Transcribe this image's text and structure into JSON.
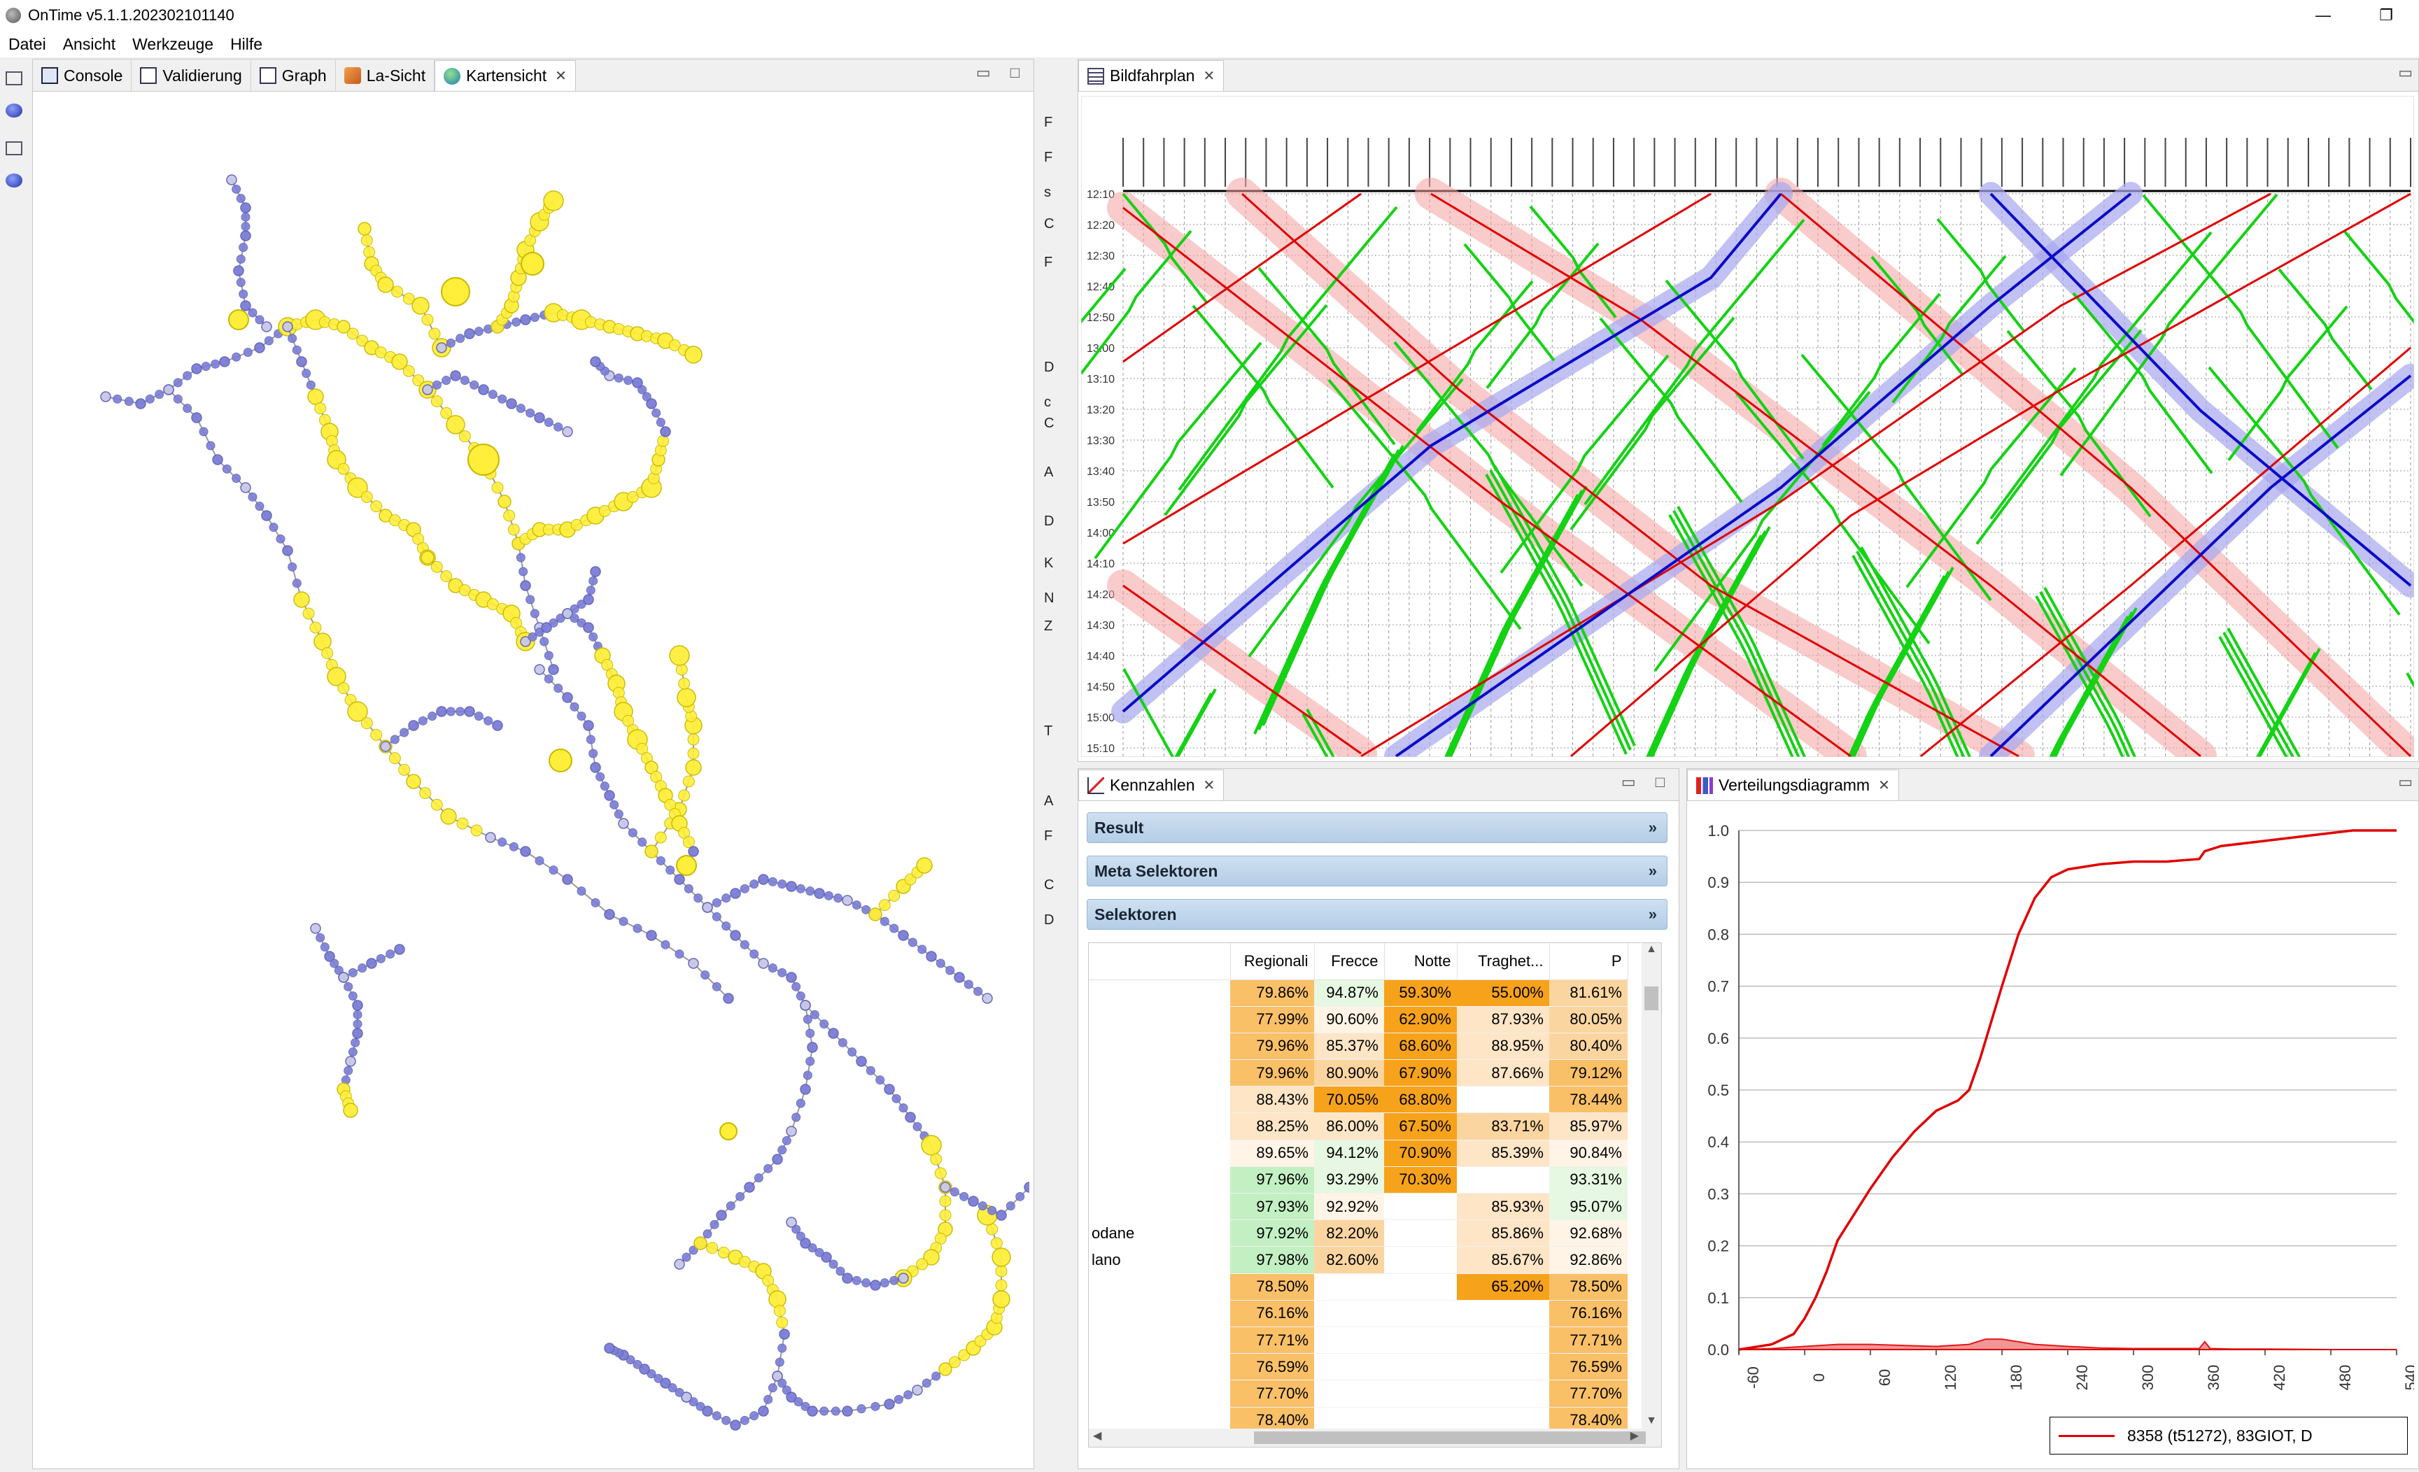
{
  "window": {
    "title": "OnTime v5.1.1.202302101140",
    "minimize": "—",
    "restore": "❐"
  },
  "menu": [
    "Datei",
    "Ansicht",
    "Werkzeuge",
    "Hilfe"
  ],
  "left_panel": {
    "tabs": [
      {
        "label": "Console",
        "icon": "console-icon"
      },
      {
        "label": "Validierung",
        "icon": "validation-icon"
      },
      {
        "label": "Graph",
        "icon": "graph-icon"
      },
      {
        "label": "La-Sicht",
        "icon": "la-view-icon"
      },
      {
        "label": "Kartensicht",
        "icon": "globe-icon",
        "active": true,
        "closable": true
      }
    ],
    "map": {
      "description_colors": {
        "lines": "#7b7ed6",
        "stations_a": "#ffef3a",
        "stations_b": "#c9c9e8"
      }
    }
  },
  "hidden_panel_letters": [
    "F",
    "F",
    "s",
    "C",
    "F",
    "D",
    "c",
    "C",
    "A",
    "D",
    "K",
    "N",
    "Z",
    "T",
    "A",
    "F",
    "C",
    "D"
  ],
  "bildfahrplan": {
    "tab_label": "Bildfahrplan",
    "time_labels": [
      "12:10",
      "12:20",
      "12:30",
      "12:40",
      "12:50",
      "13:00",
      "13:10",
      "13:20",
      "13:30",
      "13:40",
      "13:50",
      "14:00",
      "14:10",
      "14:20",
      "14:30",
      "14:40",
      "14:50",
      "15:00",
      "15:10"
    ],
    "colors": {
      "red": "#e00000",
      "blue": "#0a0ac8",
      "green": "#14d214",
      "red_band": "#f4a0a0",
      "blue_band": "#a7a7ee"
    }
  },
  "kennzahlen": {
    "tab_label": "Kennzahlen",
    "sections": [
      "Result",
      "Meta Selektoren",
      "Selektoren"
    ],
    "columns": [
      "",
      "Regionali",
      "Frecce",
      "Notte",
      "Traghet...",
      "P"
    ],
    "rows": [
      {
        "label": "",
        "cells": [
          "79.86%",
          "94.87%",
          "59.30%",
          "55.00%",
          "81.61%"
        ]
      },
      {
        "label": "",
        "cells": [
          "77.99%",
          "90.60%",
          "62.90%",
          "87.93%",
          "80.05%"
        ]
      },
      {
        "label": "",
        "cells": [
          "79.96%",
          "85.37%",
          "68.60%",
          "88.95%",
          "80.40%"
        ]
      },
      {
        "label": "",
        "cells": [
          "79.96%",
          "80.90%",
          "67.90%",
          "87.66%",
          "79.12%"
        ]
      },
      {
        "label": "",
        "cells": [
          "88.43%",
          "70.05%",
          "68.80%",
          "",
          "78.44%"
        ]
      },
      {
        "label": "",
        "cells": [
          "88.25%",
          "86.00%",
          "67.50%",
          "83.71%",
          "85.97%"
        ]
      },
      {
        "label": "",
        "cells": [
          "89.65%",
          "94.12%",
          "70.90%",
          "85.39%",
          "90.84%"
        ]
      },
      {
        "label": "",
        "cells": [
          "97.96%",
          "93.29%",
          "70.30%",
          "",
          "93.31%"
        ]
      },
      {
        "label": "",
        "cells": [
          "97.93%",
          "92.92%",
          "",
          "85.93%",
          "95.07%"
        ]
      },
      {
        "label": "odane",
        "cells": [
          "97.92%",
          "82.20%",
          "",
          "85.86%",
          "92.68%"
        ]
      },
      {
        "label": "lano",
        "cells": [
          "97.98%",
          "82.60%",
          "",
          "85.67%",
          "92.86%"
        ]
      },
      {
        "label": "",
        "cells": [
          "78.50%",
          "",
          "",
          "65.20%",
          "78.50%"
        ]
      },
      {
        "label": "",
        "cells": [
          "76.16%",
          "",
          "",
          "",
          "76.16%"
        ]
      },
      {
        "label": "",
        "cells": [
          "77.71%",
          "",
          "",
          "",
          "77.71%"
        ]
      },
      {
        "label": "",
        "cells": [
          "76.59%",
          "",
          "",
          "",
          "76.59%"
        ]
      },
      {
        "label": "",
        "cells": [
          "77.70%",
          "",
          "",
          "",
          "77.70%"
        ]
      },
      {
        "label": "",
        "cells": [
          "78.40%",
          "",
          "",
          "",
          "78.40%"
        ]
      }
    ],
    "scroll_up": "▲",
    "scroll_down": "▼",
    "scroll_left": "◀",
    "scroll_right": "▶"
  },
  "verteilung": {
    "tab_label": "Verteilungsdiagramm",
    "legend": "8358 (t51272), 83GIOT, D"
  },
  "chart_data": {
    "type": "line",
    "title": "",
    "xlabel": "",
    "ylabel": "",
    "xlim": [
      -60,
      540
    ],
    "ylim": [
      0,
      1.0
    ],
    "x_ticks": [
      "-60",
      "0",
      "60",
      "120",
      "180",
      "240",
      "300",
      "360",
      "420",
      "480",
      "540"
    ],
    "y_ticks": [
      "0.0",
      "0.1",
      "0.2",
      "0.3",
      "0.4",
      "0.5",
      "0.6",
      "0.7",
      "0.8",
      "0.9",
      "1.0"
    ],
    "grid": "horizontal",
    "legend_position": "bottom-right",
    "series": [
      {
        "name": "8358 (t51272), 83GIOT, D",
        "color": "#e00000",
        "x": [
          -60,
          -30,
          -10,
          0,
          10,
          20,
          30,
          45,
          60,
          80,
          100,
          120,
          140,
          150,
          160,
          170,
          180,
          195,
          210,
          225,
          240,
          270,
          300,
          330,
          360,
          365,
          380,
          420,
          460,
          500,
          540
        ],
        "y": [
          0.0,
          0.01,
          0.03,
          0.06,
          0.1,
          0.15,
          0.21,
          0.26,
          0.31,
          0.37,
          0.42,
          0.46,
          0.48,
          0.5,
          0.56,
          0.63,
          0.7,
          0.8,
          0.87,
          0.91,
          0.925,
          0.935,
          0.94,
          0.94,
          0.945,
          0.96,
          0.97,
          0.98,
          0.99,
          1.0,
          1.0
        ]
      }
    ],
    "density": {
      "color": "#e00000",
      "x": [
        -60,
        -30,
        0,
        30,
        60,
        90,
        120,
        150,
        165,
        180,
        195,
        210,
        240,
        270,
        300,
        330,
        360,
        365,
        370,
        390,
        420,
        480,
        540
      ],
      "y": [
        0.0,
        0.002,
        0.006,
        0.01,
        0.01,
        0.008,
        0.006,
        0.01,
        0.02,
        0.02,
        0.015,
        0.01,
        0.006,
        0.003,
        0.002,
        0.002,
        0.002,
        0.015,
        0.002,
        0.001,
        0.001,
        0.0,
        0.0
      ]
    }
  }
}
